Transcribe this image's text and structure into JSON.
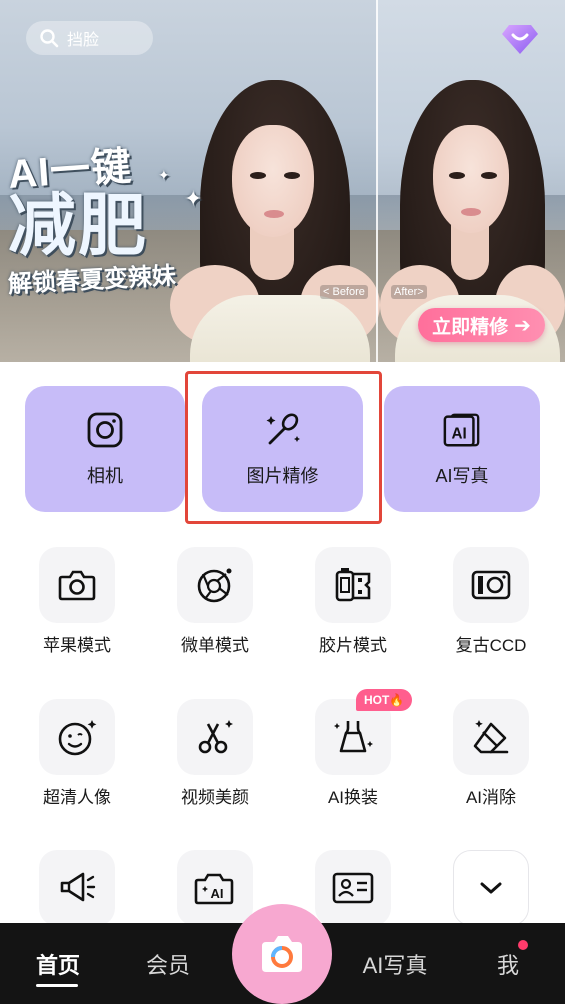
{
  "search": {
    "placeholder": "挡脸"
  },
  "banner": {
    "headline_line1": "AI一键",
    "headline_line2": "减肥",
    "headline_line3": "解锁春夏变辣妹",
    "before_label": "< Before",
    "after_label": "After>",
    "cta_label": "立即精修",
    "cta_arrow": "➔"
  },
  "main_features": [
    {
      "label": "相机",
      "icon": "camera-icon"
    },
    {
      "label": "图片精修",
      "icon": "magic-wand-icon"
    },
    {
      "label": "AI写真",
      "icon": "ai-portrait-icon"
    }
  ],
  "tools": [
    {
      "label": "苹果模式",
      "icon": "camera-icon"
    },
    {
      "label": "微单模式",
      "icon": "aperture-icon"
    },
    {
      "label": "胶片模式",
      "icon": "film-roll-icon"
    },
    {
      "label": "复古CCD",
      "icon": "retro-camera-icon"
    },
    {
      "label": "超清人像",
      "icon": "face-sparkle-icon"
    },
    {
      "label": "视频美颜",
      "icon": "scissors-icon"
    },
    {
      "label": "AI换装",
      "icon": "dress-icon",
      "badge": "HOT🔥"
    },
    {
      "label": "AI消除",
      "icon": "eraser-icon"
    }
  ],
  "nav": {
    "home": "首页",
    "member": "会员",
    "ai_portrait": "AI写真",
    "me": "我"
  },
  "colors": {
    "main_card": "#c7bcf8",
    "cta_pink": "#ff6f9b",
    "nav_bg": "#141414",
    "camera_button": "#f7a8d0",
    "highlight_border": "#e2463a"
  }
}
